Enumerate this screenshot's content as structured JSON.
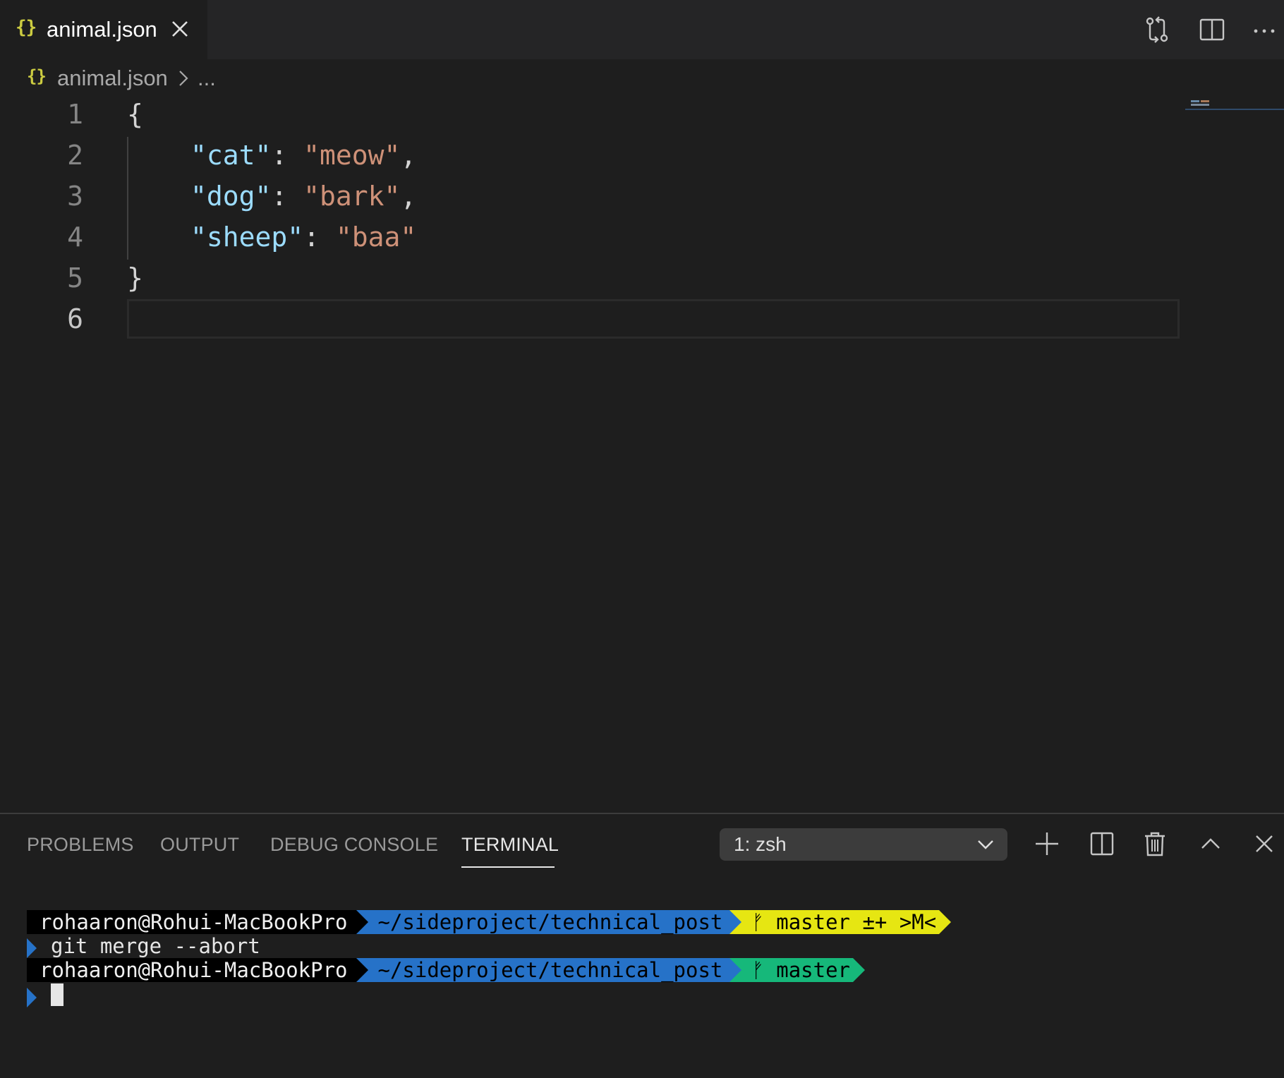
{
  "tab": {
    "icon": "json-braces-icon",
    "label": "animal.json"
  },
  "breadcrumb": {
    "file": "animal.json",
    "more": "..."
  },
  "editor": {
    "lines": [
      {
        "number": "1",
        "text": "{"
      },
      {
        "number": "2",
        "key": "\"cat\"",
        "value": "\"meow\"",
        "trail": ","
      },
      {
        "number": "3",
        "key": "\"dog\"",
        "value": "\"bark\"",
        "trail": ","
      },
      {
        "number": "4",
        "key": "\"sheep\"",
        "value": "\"baa\"",
        "trail": ""
      },
      {
        "number": "5",
        "text": "}"
      },
      {
        "number": "6",
        "text": ""
      }
    ]
  },
  "panel": {
    "tabs": [
      {
        "label": "PROBLEMS"
      },
      {
        "label": "OUTPUT"
      },
      {
        "label": "DEBUG CONSOLE"
      },
      {
        "label": "TERMINAL"
      }
    ],
    "terminal_select": "1: zsh"
  },
  "terminal": {
    "prompt1": {
      "user": "rohaaron@Rohui-MacBookPro",
      "path": "~/sideproject/technical_post",
      "git": "ᚠ master ±+ >M<"
    },
    "command1": "git merge --abort",
    "prompt2": {
      "user": "rohaaron@Rohui-MacBookPro",
      "path": "~/sideproject/technical_post",
      "git": "ᚠ master"
    }
  },
  "colors": {
    "key": "#9cdcfe",
    "string": "#ce9178",
    "json_icon": "#cbcb41",
    "path_segment": "#2672c8",
    "git_dirty": "#e6e612",
    "git_clean": "#16b87a"
  }
}
